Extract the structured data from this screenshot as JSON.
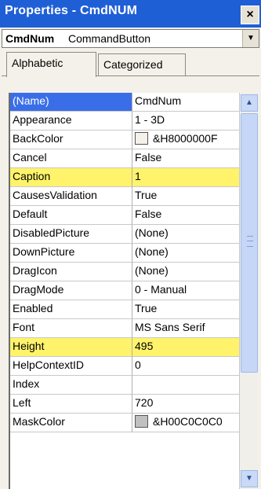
{
  "window": {
    "title": "Properties - CmdNUM",
    "close_label": "×"
  },
  "object_selector": {
    "name": "CmdNum",
    "type": "CommandButton",
    "dropdown_glyph": "▼"
  },
  "tabs": [
    {
      "label": "Alphabetic",
      "active": true
    },
    {
      "label": "Categorized",
      "active": false
    }
  ],
  "properties": [
    {
      "name": "(Name)",
      "value": "CmdNum",
      "selected": true
    },
    {
      "name": "Appearance",
      "value": "1 - 3D"
    },
    {
      "name": "BackColor",
      "value": "&H8000000F",
      "swatch": "#f3f1ea"
    },
    {
      "name": "Cancel",
      "value": "False"
    },
    {
      "name": "Caption",
      "value": "1",
      "highlight": true
    },
    {
      "name": "CausesValidation",
      "value": "True"
    },
    {
      "name": "Default",
      "value": "False"
    },
    {
      "name": "DisabledPicture",
      "value": "(None)"
    },
    {
      "name": "DownPicture",
      "value": "(None)"
    },
    {
      "name": "DragIcon",
      "value": "(None)"
    },
    {
      "name": "DragMode",
      "value": "0 - Manual"
    },
    {
      "name": "Enabled",
      "value": "True"
    },
    {
      "name": "Font",
      "value": "MS Sans Serif"
    },
    {
      "name": "Height",
      "value": "495",
      "highlight": true
    },
    {
      "name": "HelpContextID",
      "value": "0"
    },
    {
      "name": "Index",
      "value": ""
    },
    {
      "name": "Left",
      "value": "720"
    },
    {
      "name": "MaskColor",
      "value": "&H00C0C0C0",
      "swatch": "#c0c0c0"
    }
  ],
  "scrollbar": {
    "up_glyph": "▲",
    "down_glyph": "▼"
  },
  "colors": {
    "title_bar": "#1f5fd6",
    "selection": "#3a6ee8",
    "highlight": "#fff36b"
  }
}
